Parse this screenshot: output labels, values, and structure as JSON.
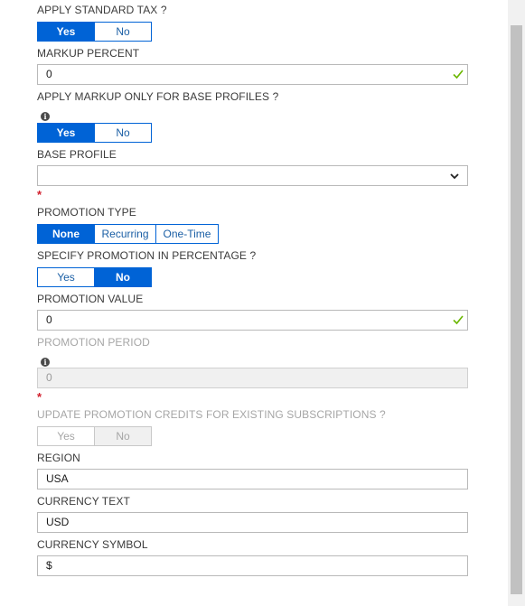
{
  "form": {
    "standard_tax": {
      "label": "APPLY STANDARD TAX ?",
      "options": [
        "Yes",
        "No"
      ],
      "selected": "Yes"
    },
    "markup_percent": {
      "label": "MARKUP PERCENT",
      "value": "0",
      "valid": true
    },
    "markup_base_only": {
      "label": "APPLY MARKUP ONLY FOR BASE PROFILES ?",
      "info_icon": "info-icon",
      "options": [
        "Yes",
        "No"
      ],
      "selected": "Yes"
    },
    "base_profile": {
      "label": "BASE PROFILE",
      "value": "",
      "required_mark": "*",
      "dropdown_icon": "chevron-down-icon"
    },
    "promotion_type": {
      "label": "PROMOTION TYPE",
      "options": [
        "None",
        "Recurring",
        "One-Time"
      ],
      "selected": "None"
    },
    "promotion_percentage": {
      "label": "SPECIFY PROMOTION IN PERCENTAGE ?",
      "options": [
        "Yes",
        "No"
      ],
      "selected": "No"
    },
    "promotion_value": {
      "label": "PROMOTION VALUE",
      "value": "0",
      "valid": true
    },
    "promotion_period": {
      "label": "PROMOTION PERIOD",
      "info_icon": "info-icon",
      "value": "0",
      "disabled": true,
      "required_mark": "*"
    },
    "update_credits": {
      "label": "UPDATE PROMOTION CREDITS FOR EXISTING SUBSCRIPTIONS ?",
      "options": [
        "Yes",
        "No"
      ],
      "selected": "No",
      "disabled": true
    },
    "region": {
      "label": "REGION",
      "value": "USA"
    },
    "currency_text": {
      "label": "CURRENCY TEXT",
      "value": "USD"
    },
    "currency_symbol": {
      "label": "CURRENCY SYMBOL",
      "value": "$"
    }
  },
  "colors": {
    "accent": "#0063d6",
    "valid": "#6bb700",
    "required": "#d21f2c"
  }
}
